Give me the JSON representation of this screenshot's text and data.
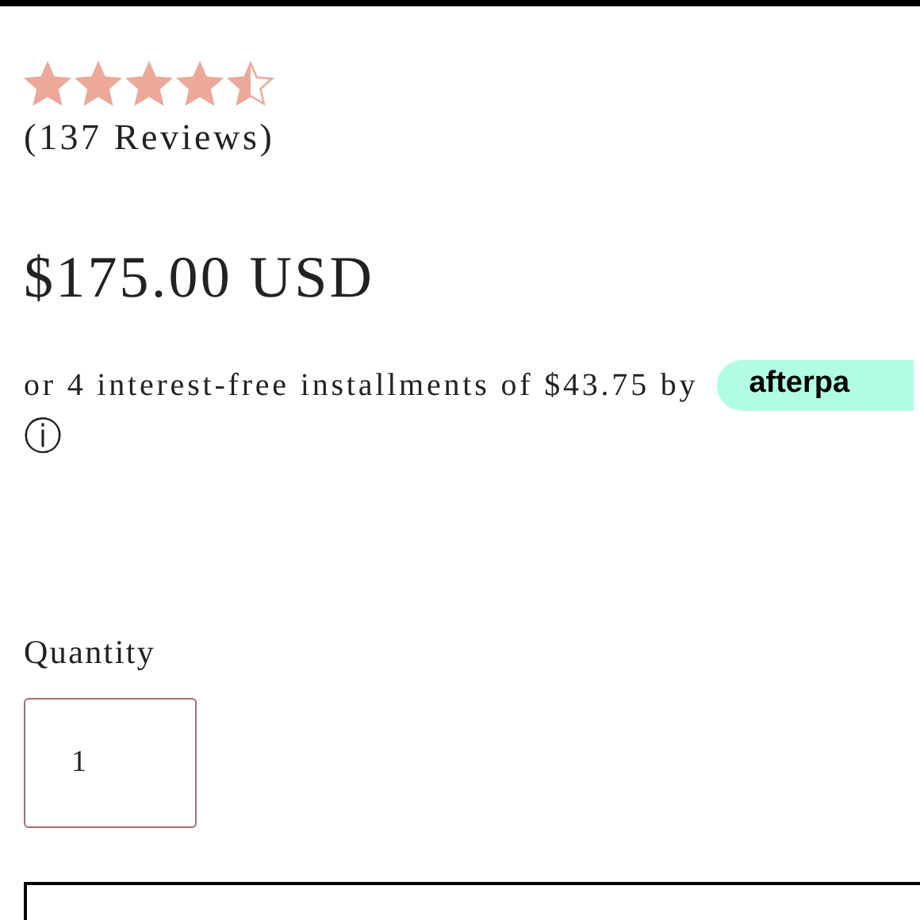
{
  "rating": {
    "stars": 4.5,
    "reviews": "(137 Reviews)"
  },
  "price": "$175.00 USD",
  "installments": {
    "text": "or 4 interest-free installments of $43.75 by",
    "badge": "afterpa",
    "info_icon": "ⓘ"
  },
  "quantity": {
    "label": "Quantity",
    "value": "1"
  }
}
